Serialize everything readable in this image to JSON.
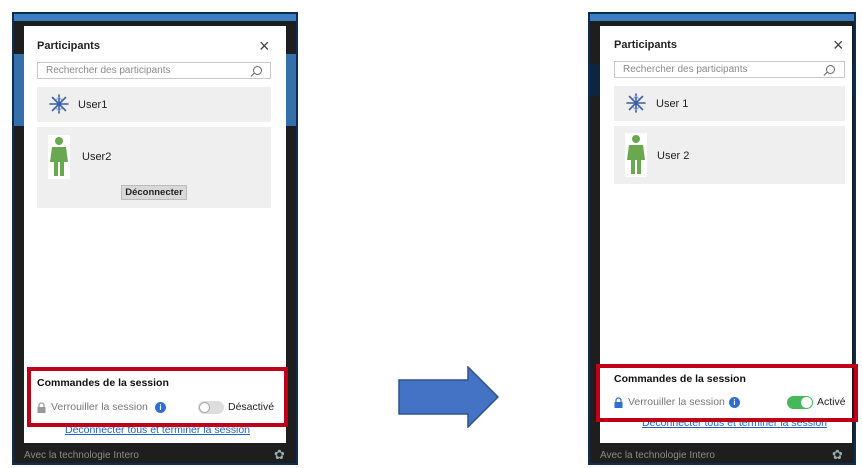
{
  "before": {
    "panel_title": "Participants",
    "search_placeholder": "Rechercher des participants",
    "users": [
      {
        "name": "User1",
        "avatar": "snowflake-avatar-icon"
      },
      {
        "name": "User2",
        "avatar": "person-avatar-icon"
      }
    ],
    "disconnect_label": "Déconnecter",
    "session_title": "Commandes de la session",
    "lock_label": "Verrouiller la session",
    "lock_state": "Désactivé",
    "lock_on": false,
    "end_link": "Déconnecter tous et terminer la session",
    "footer_text": "Avec la technologie Intero"
  },
  "after": {
    "panel_title": "Participants",
    "search_placeholder": "Rechercher des participants",
    "users": [
      {
        "name": "User 1",
        "avatar": "snowflake-avatar-icon"
      },
      {
        "name": "User 2",
        "avatar": "person-avatar-icon"
      }
    ],
    "session_title": "Commandes de la session",
    "lock_label": "Verrouiller la session",
    "lock_state": "Activé",
    "lock_on": true,
    "end_link": "Déconnecter tous et terminer la session",
    "footer_text": "Avec la technologie Intero"
  },
  "colors": {
    "toggle_on": "#44b85a",
    "toggle_off": "#dddddd",
    "highlight_frame": "#c00018",
    "arrow": "#4472c4",
    "link": "#1f63c9",
    "lock_active": "#2d6fd2"
  }
}
